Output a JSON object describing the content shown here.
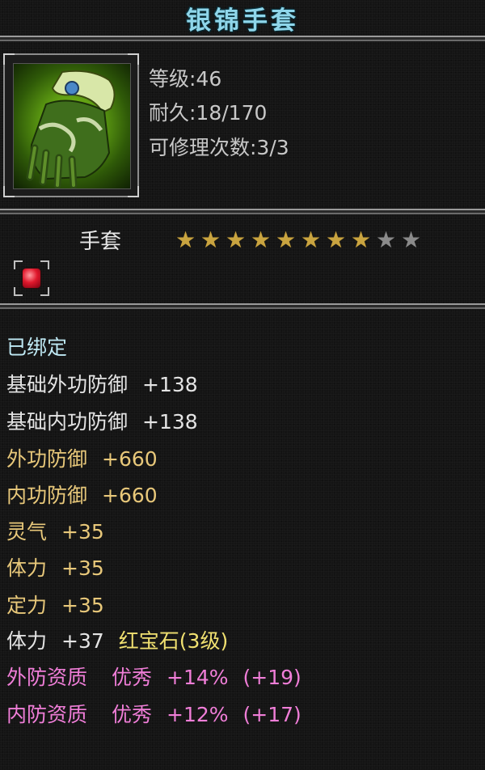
{
  "item": {
    "name": "银锦手套",
    "level_line": "等级:46",
    "durability_line": "耐久:18/170",
    "repair_line": "可修理次数:3/3",
    "type": "手套",
    "stars_filled": 8,
    "stars_total": 10,
    "icon": "green-glove-icon",
    "gem_icon": "red-gem-icon"
  },
  "attributes": {
    "bound": "已绑定",
    "base_outer_def": {
      "label": "基础外功防御",
      "value": "+138"
    },
    "base_inner_def": {
      "label": "基础内功防御",
      "value": "+138"
    },
    "outer_def": {
      "label": "外功防御",
      "value": "+660"
    },
    "inner_def": {
      "label": "内功防御",
      "value": "+660"
    },
    "spirit": {
      "label": "灵气",
      "value": "+35"
    },
    "stamina": {
      "label": "体力",
      "value": "+35"
    },
    "focus": {
      "label": "定力",
      "value": "+35"
    },
    "gem_bonus": {
      "label": "体力",
      "value": "+37",
      "gem": "红宝石(3级)"
    },
    "outer_quality": {
      "label": "外防资质",
      "grade": "优秀",
      "value": "+14%",
      "extra": "(+19)"
    },
    "inner_quality": {
      "label": "内防资质",
      "grade": "优秀",
      "value": "+12%",
      "extra": "(+17)"
    }
  },
  "colors": {
    "title": "#8fd6ea",
    "bound": "#bfe9f4",
    "base": "#e4e4e4",
    "bonus": "#e8c87a",
    "gem": "#f0e070",
    "quality": "#f07ed8",
    "star_on": "#c9a440",
    "star_off": "#8a8a8a"
  }
}
